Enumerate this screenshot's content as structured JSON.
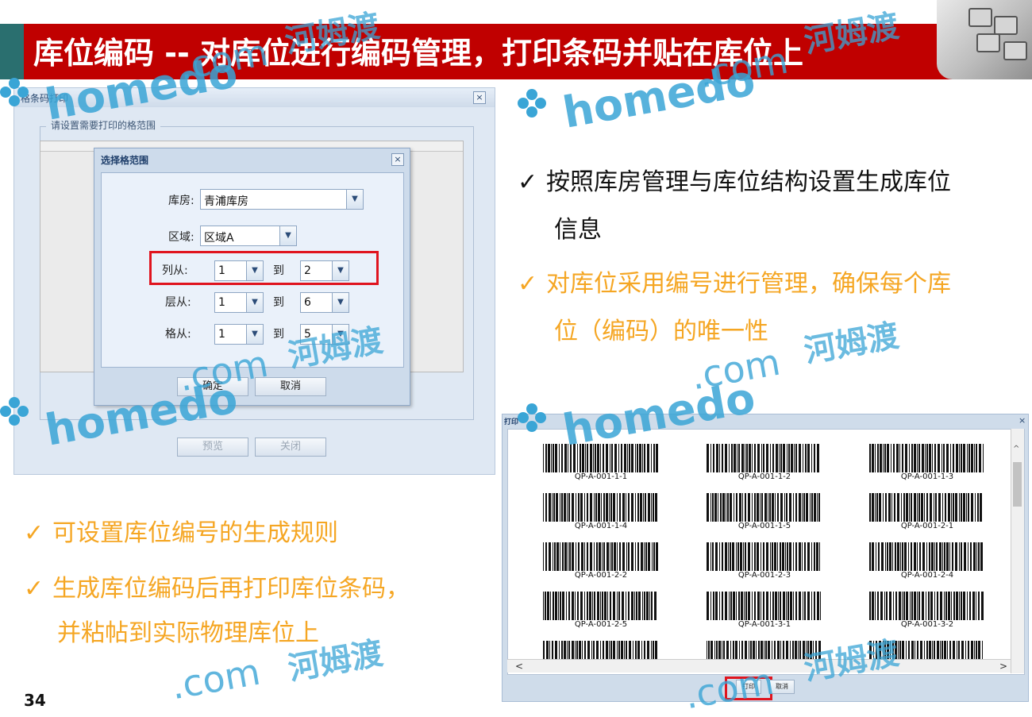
{
  "slide": {
    "title": "库位编码 -- 对库位进行编码管理，打印条码并贴在库位上",
    "page_number": "34",
    "colors": {
      "banner": "#c00000",
      "accent": "#2a6f6f",
      "highlight": "#f5a623",
      "watermark": "#3aa5d6"
    }
  },
  "watermark": {
    "logo": "homedo",
    "com": ".com",
    "cn": "河姆渡"
  },
  "barcode_window": {
    "title": "格条码打印",
    "group_label": "请设置需要打印的格范围",
    "close": "×",
    "preview_button": "预览",
    "close_button": "关闭"
  },
  "range_dialog": {
    "title": "选择格范围",
    "close": "×",
    "warehouse_label": "库房:",
    "warehouse_value": "青浦库房",
    "area_label": "区域:",
    "area_value": "区域A",
    "col_label": "列从:",
    "col_from": "1",
    "col_to": "2",
    "layer_label": "层从:",
    "layer_from": "1",
    "layer_to": "6",
    "cell_label": "格从:",
    "cell_from": "1",
    "cell_to": "5",
    "to_label": "到",
    "confirm_button": "确定",
    "cancel_button": "取消"
  },
  "bullets_right": [
    {
      "line1": "按照库房管理与库位结构设置生成库位",
      "line2": "信息"
    },
    {
      "line1": "对库位采用编号进行管理，确保每个库",
      "line2": "位（编码）的唯一性"
    }
  ],
  "bullets_left": [
    {
      "line1": "可设置库位编号的生成规则"
    },
    {
      "line1": "生成库位编码后再打印库位条码，",
      "line2": "并粘帖到实际物理库位上"
    }
  ],
  "check_mark": "✓",
  "print_window": {
    "title": "打印",
    "close": "×",
    "print_button": "打印",
    "cancel_button": "取消",
    "labels": [
      "QP-A-001-1-1",
      "QP-A-001-1-2",
      "QP-A-001-1-3",
      "QP-A-001-1-4",
      "QP-A-001-1-5",
      "QP-A-001-2-1",
      "QP-A-001-2-2",
      "QP-A-001-2-3",
      "QP-A-001-2-4",
      "QP-A-001-2-5",
      "QP-A-001-3-1",
      "QP-A-001-3-2"
    ]
  }
}
